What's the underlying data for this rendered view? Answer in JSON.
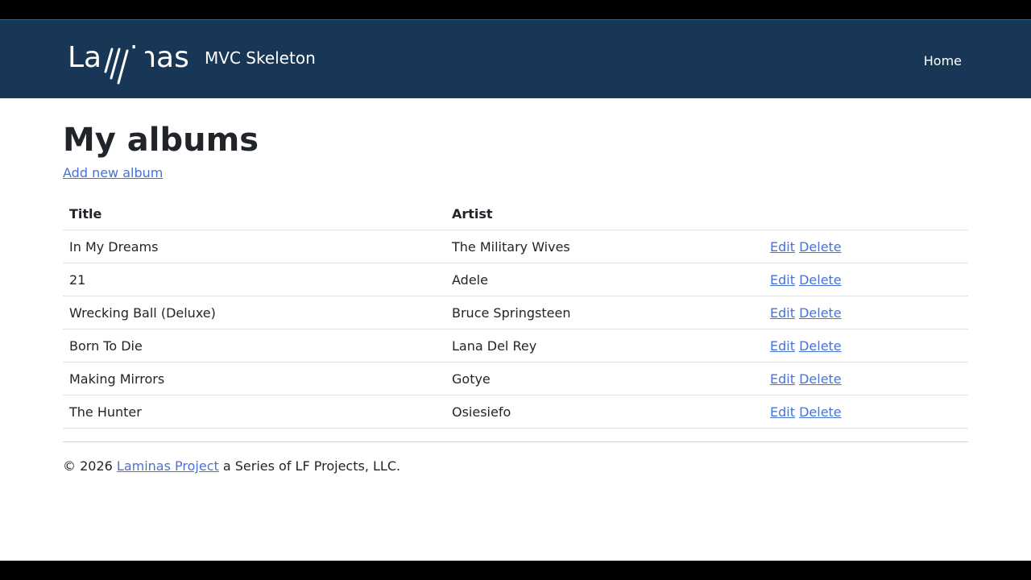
{
  "header": {
    "brand_name": "Laminas",
    "brand_subtitle": "MVC Skeleton",
    "nav_home": "Home",
    "bg_color": "#183655"
  },
  "main": {
    "title": "My albums",
    "add_link": "Add new album",
    "table": {
      "headers": [
        "Title",
        "Artist",
        ""
      ],
      "rows": [
        {
          "title": "In My Dreams",
          "artist": "The Military Wives",
          "edit": "Edit",
          "delete": "Delete"
        },
        {
          "title": "21",
          "artist": "Adele",
          "edit": "Edit",
          "delete": "Delete"
        },
        {
          "title": "Wrecking Ball (Deluxe)",
          "artist": "Bruce Springsteen",
          "edit": "Edit",
          "delete": "Delete"
        },
        {
          "title": "Born To Die",
          "artist": "Lana Del Rey",
          "edit": "Edit",
          "delete": "Delete"
        },
        {
          "title": "Making Mirrors",
          "artist": "Gotye",
          "edit": "Edit",
          "delete": "Delete"
        },
        {
          "title": "The Hunter",
          "artist": "Osiesiefo",
          "edit": "Edit",
          "delete": "Delete"
        }
      ]
    },
    "link_color": "#4a72d1"
  },
  "footer": {
    "copyright": "© 2026",
    "link_text": "Laminas Project",
    "suffix": "a Series of LF Projects, LLC."
  }
}
